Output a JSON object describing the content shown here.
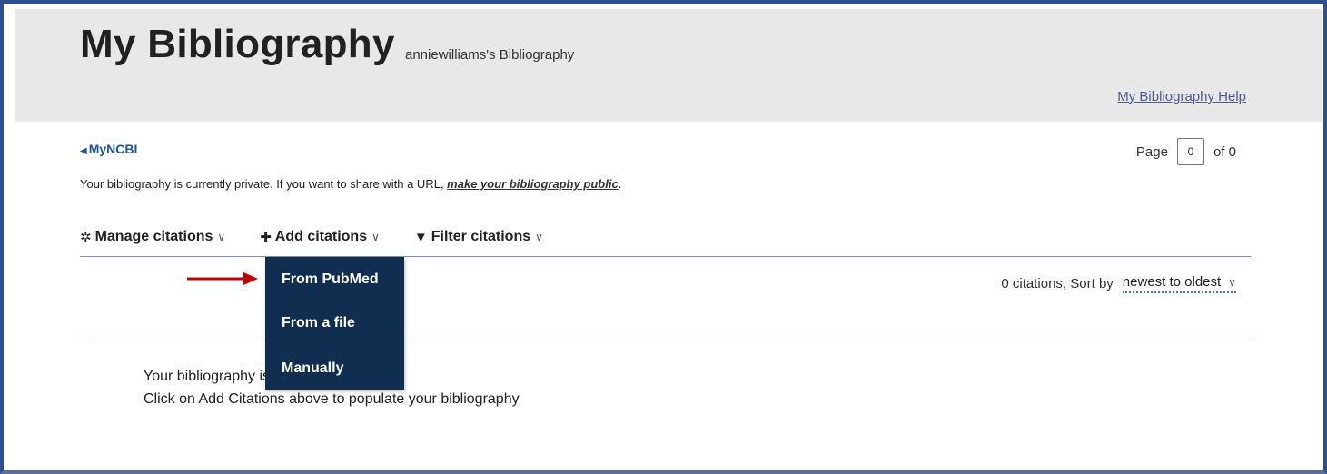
{
  "header": {
    "title": "My Bibliography",
    "subtitle": "anniewilliams's Bibliography",
    "help_link": "My Bibliography Help"
  },
  "nav": {
    "back_link": "MyNCBI",
    "back_icon": "chevron-left-icon"
  },
  "pager": {
    "page_label": "Page",
    "page_value": "0",
    "of_label": "of 0"
  },
  "privacy": {
    "text": "Your bibliography is currently private. If you want to share with a URL, ",
    "link": "make your bibliography public",
    "suffix": "."
  },
  "toolbar": {
    "manage": {
      "label": "Manage citations",
      "icon": "gear-icon"
    },
    "add": {
      "label": "Add citations",
      "icon": "plus-icon"
    },
    "filter": {
      "label": "Filter citations",
      "icon": "filter-icon"
    }
  },
  "add_menu": {
    "items": [
      "From PubMed",
      "From a file",
      "Manually"
    ]
  },
  "sort": {
    "count_text": "0 citations, Sort by",
    "selected": "newest to oldest"
  },
  "empty": {
    "line1": "Your bibliography is empty.",
    "line2": "Click on Add Citations above to populate your bibliography"
  },
  "colors": {
    "header_bg": "#e8e8e8",
    "menu_bg": "#112e51",
    "link": "#205493",
    "annotation_arrow": "#c00000",
    "frame_border": "#2f4f8f"
  }
}
